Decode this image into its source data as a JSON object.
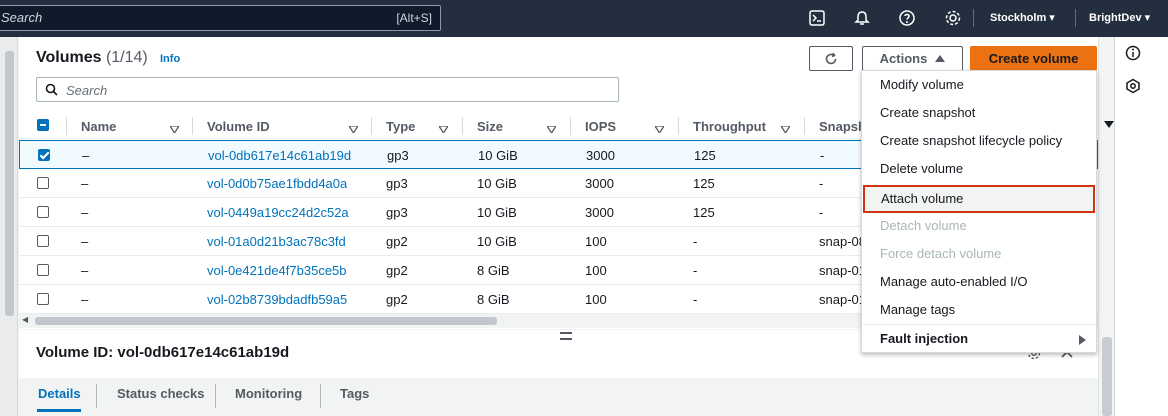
{
  "topbar": {
    "search_placeholder": "Search",
    "search_shortcut": "[Alt+S]",
    "region": "Stockholm",
    "account": "BrightDev"
  },
  "header": {
    "title": "Volumes",
    "count": "(1/14)",
    "info": "Info",
    "actions_label": "Actions",
    "create_label": "Create volume",
    "search_placeholder": "Search"
  },
  "table": {
    "columns": [
      "Name",
      "Volume ID",
      "Type",
      "Size",
      "IOPS",
      "Throughput",
      "Snapsh"
    ],
    "rows": [
      {
        "name": "–",
        "id": "vol-0db617e14c61ab19d",
        "type": "gp3",
        "size": "10 GiB",
        "iops": "3000",
        "throughput": "125",
        "snapshot": "-",
        "selected": true
      },
      {
        "name": "–",
        "id": "vol-0d0b75ae1fbdd4a0a",
        "type": "gp3",
        "size": "10 GiB",
        "iops": "3000",
        "throughput": "125",
        "snapshot": "-",
        "selected": false
      },
      {
        "name": "–",
        "id": "vol-0449a19cc24d2c52a",
        "type": "gp3",
        "size": "10 GiB",
        "iops": "3000",
        "throughput": "125",
        "snapshot": "-",
        "selected": false
      },
      {
        "name": "–",
        "id": "vol-01a0d21b3ac78c3fd",
        "type": "gp2",
        "size": "10 GiB",
        "iops": "100",
        "throughput": "-",
        "snapshot": "snap-08",
        "selected": false
      },
      {
        "name": "–",
        "id": "vol-0e421de4f7b35ce5b",
        "type": "gp2",
        "size": "8 GiB",
        "iops": "100",
        "throughput": "-",
        "snapshot": "snap-01",
        "selected": false
      },
      {
        "name": "–",
        "id": "vol-02b8739bdadfb59a5",
        "type": "gp2",
        "size": "8 GiB",
        "iops": "100",
        "throughput": "-",
        "snapshot": "snap-01",
        "selected": false
      }
    ]
  },
  "menu": {
    "items": [
      {
        "label": "Modify volume",
        "state": "normal"
      },
      {
        "label": "Create snapshot",
        "state": "normal"
      },
      {
        "label": "Create snapshot lifecycle policy",
        "state": "normal"
      },
      {
        "label": "Delete volume",
        "state": "normal"
      },
      {
        "label": "Attach volume",
        "state": "highlight"
      },
      {
        "label": "Detach volume",
        "state": "disabled"
      },
      {
        "label": "Force detach volume",
        "state": "disabled"
      },
      {
        "label": "Manage auto-enabled I/O",
        "state": "normal"
      },
      {
        "label": "Manage tags",
        "state": "normal"
      },
      {
        "label": "Fault injection",
        "state": "submenu"
      }
    ]
  },
  "details": {
    "title": "Volume ID: vol-0db617e14c61ab19d",
    "tabs": [
      "Details",
      "Status checks",
      "Monitoring",
      "Tags"
    ]
  },
  "colors": {
    "topbar": "#232f3e",
    "link": "#0073bb",
    "primary_button": "#ec7211",
    "highlight_border": "#d13212"
  }
}
